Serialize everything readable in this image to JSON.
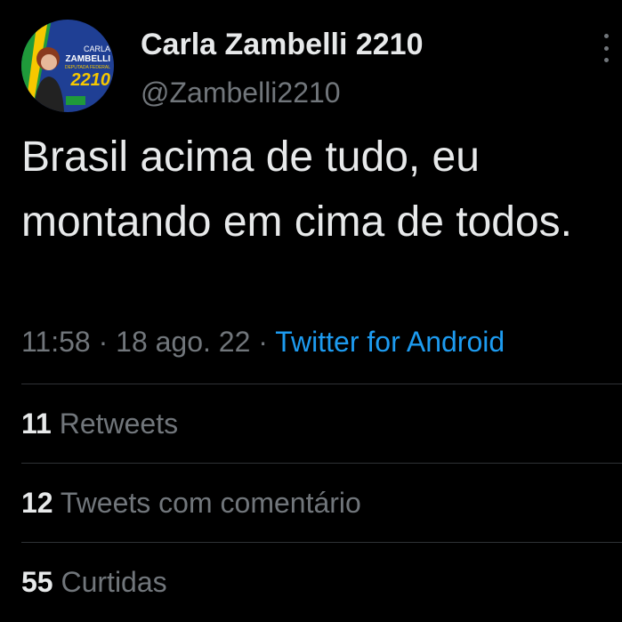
{
  "author": {
    "display_name": "Carla Zambelli 2210",
    "handle": "@Zambelli2210",
    "avatar_lines": [
      "CARLA",
      "ZAMBELLI",
      "DEPUTADA FEDERAL",
      "2210"
    ]
  },
  "tweet": {
    "text": "Brasil acima de tudo, eu montando em cima de todos.",
    "time": "11:58",
    "date": "18 ago. 22",
    "separator": "·",
    "source": "Twitter for Android"
  },
  "stats": [
    {
      "count": "11",
      "label": "Retweets"
    },
    {
      "count": "12",
      "label": "Tweets com comentário"
    },
    {
      "count": "55",
      "label": "Curtidas"
    }
  ],
  "icons": {
    "more": "more-vertical-icon"
  },
  "colors": {
    "background": "#000000",
    "primary_text": "#e7e9ea",
    "secondary_text": "#71767b",
    "link": "#1d9bf0",
    "divider": "#2f3336",
    "avatar_blue": "#1f3f94",
    "avatar_green": "#1f9a3a",
    "avatar_yellow": "#f6c800"
  }
}
